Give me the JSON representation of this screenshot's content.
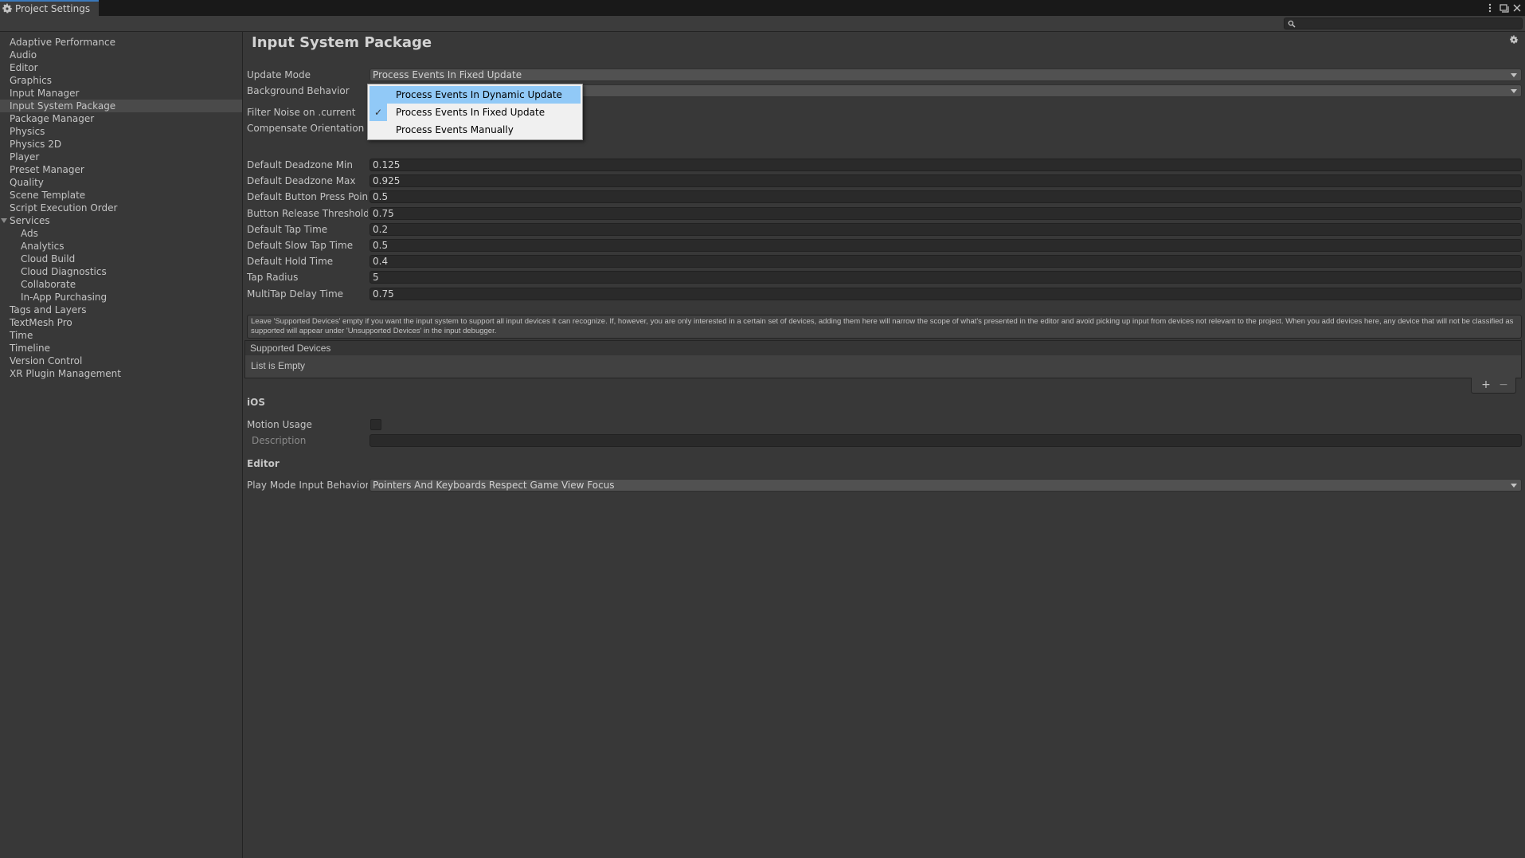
{
  "window": {
    "tab_title": "Project Settings",
    "controls": [
      "more-options",
      "maximize",
      "close"
    ]
  },
  "search": {
    "placeholder": "",
    "value": ""
  },
  "sidebar": {
    "items": [
      {
        "label": "Adaptive Performance"
      },
      {
        "label": "Audio"
      },
      {
        "label": "Editor"
      },
      {
        "label": "Graphics"
      },
      {
        "label": "Input Manager"
      },
      {
        "label": "Input System Package",
        "selected": true
      },
      {
        "label": "Package Manager"
      },
      {
        "label": "Physics"
      },
      {
        "label": "Physics 2D"
      },
      {
        "label": "Player"
      },
      {
        "label": "Preset Manager"
      },
      {
        "label": "Quality"
      },
      {
        "label": "Scene Template"
      },
      {
        "label": "Script Execution Order"
      },
      {
        "label": "Services",
        "expanded": true
      },
      {
        "label": "Ads",
        "child": true
      },
      {
        "label": "Analytics",
        "child": true
      },
      {
        "label": "Cloud Build",
        "child": true
      },
      {
        "label": "Cloud Diagnostics",
        "child": true
      },
      {
        "label": "Collaborate",
        "child": true
      },
      {
        "label": "In-App Purchasing",
        "child": true
      },
      {
        "label": "Tags and Layers"
      },
      {
        "label": "TextMesh Pro"
      },
      {
        "label": "Time"
      },
      {
        "label": "Timeline"
      },
      {
        "label": "Version Control"
      },
      {
        "label": "XR Plugin Management"
      }
    ]
  },
  "main": {
    "title": "Input System Package",
    "update_mode": {
      "label": "Update Mode",
      "value": "Process Events In Fixed Update"
    },
    "background_behavior": {
      "label": "Background Behavior",
      "value": ""
    },
    "filter_noise": {
      "label": "Filter Noise on .current"
    },
    "compensate_orientation": {
      "label": "Compensate Orientation"
    },
    "fields": [
      {
        "label": "Default Deadzone Min",
        "value": "0.125"
      },
      {
        "label": "Default Deadzone Max",
        "value": "0.925"
      },
      {
        "label": "Default Button Press Point",
        "value": "0.5"
      },
      {
        "label": "Button Release Threshold",
        "value": "0.75"
      },
      {
        "label": "Default Tap Time",
        "value": "0.2"
      },
      {
        "label": "Default Slow Tap Time",
        "value": "0.5"
      },
      {
        "label": "Default Hold Time",
        "value": "0.4"
      },
      {
        "label": "Tap Radius",
        "value": "5"
      },
      {
        "label": "MultiTap Delay Time",
        "value": "0.75"
      }
    ],
    "help_text": "Leave 'Supported Devices' empty if you want the input system to support all input devices it can recognize. If, however, you are only interested in a certain set of devices, adding them here will narrow the scope of what's presented in the editor and avoid picking up input from devices not relevant to the project. When you add devices here, any device that will not be classified as supported will appear under 'Unsupported Devices' in the input debugger.",
    "supported_devices": {
      "header": "Supported Devices",
      "empty_text": "List is Empty",
      "add": "+",
      "remove": "−"
    },
    "ios": {
      "heading": "iOS",
      "motion_usage": {
        "label": "Motion Usage",
        "checked": false
      },
      "description": {
        "label": "Description",
        "value": ""
      }
    },
    "editor": {
      "heading": "Editor",
      "play_mode": {
        "label": "Play Mode Input Behavior",
        "value": "Pointers And Keyboards Respect Game View Focus"
      }
    }
  },
  "popup": {
    "options": [
      {
        "label": "Process Events In Dynamic Update",
        "hovered": true,
        "checked": false
      },
      {
        "label": "Process Events In Fixed Update",
        "hovered": false,
        "checked": true
      },
      {
        "label": "Process Events Manually",
        "hovered": false,
        "checked": false
      }
    ],
    "check_glyph": "✓"
  },
  "colors": {
    "accent_tab": "#3a79bb",
    "popup_highlight": "#91c9f7"
  }
}
